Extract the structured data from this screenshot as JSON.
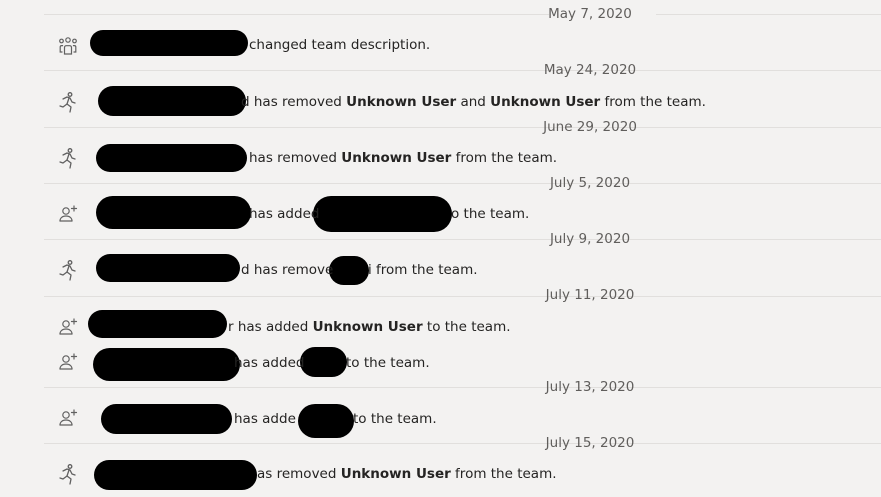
{
  "feed": {
    "dates": [
      "May 7, 2020",
      "May 24, 2020",
      "June 29, 2020",
      "July 5, 2020",
      "July 9, 2020",
      "July 11, 2020",
      "July 13, 2020",
      "July 15, 2020"
    ],
    "events": [
      {
        "icon": "team-icon",
        "frag": "changed team description."
      },
      {
        "icon": "leave-icon",
        "frag_pre": "d has removed ",
        "user1": "Unknown User",
        "mid": " and ",
        "user2": "Unknown User",
        "post": " from the team."
      },
      {
        "icon": "leave-icon",
        "frag_pre": "has removed ",
        "user1": "Unknown User",
        "post": " from the team."
      },
      {
        "icon": "add-person-icon",
        "frag_pre": "has added",
        "post": "o the team."
      },
      {
        "icon": "leave-icon",
        "frag_pre": "d has remove",
        "post": "i from the team."
      },
      {
        "icon": "add-person-icon",
        "frag_pre": "r has added ",
        "user1": "Unknown User",
        "post": " to the team."
      },
      {
        "icon": "add-person-icon",
        "frag_pre": "has added",
        "post": " to the team."
      },
      {
        "icon": "add-person-icon",
        "frag_pre": "has adde",
        "post": " to the team."
      },
      {
        "icon": "leave-icon",
        "frag_pre": "as removed ",
        "user1": "Unknown User",
        "post": " from the team."
      }
    ]
  }
}
